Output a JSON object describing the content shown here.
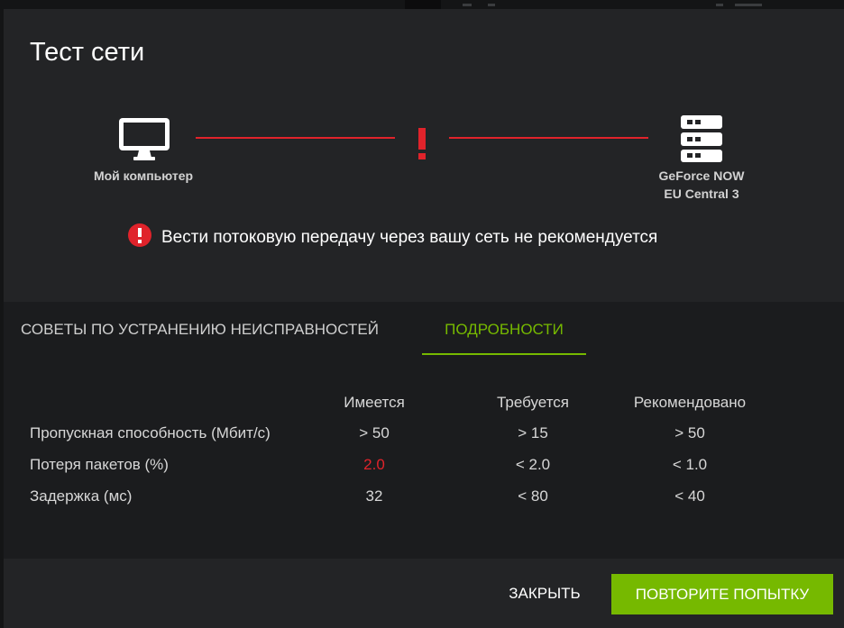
{
  "dialog": {
    "title": "Тест сети"
  },
  "diagram": {
    "source": {
      "label": "Мой компьютер",
      "icon": "monitor-icon"
    },
    "destination": {
      "label_line1": "GeForce NOW",
      "label_line2": "EU Central 3",
      "icon": "server-rack-icon"
    },
    "connection_status": "!",
    "connection_color": "#e0232b"
  },
  "warning": {
    "icon": "error-circle-icon",
    "text": "Вести потоковую передачу через вашу сеть не рекомендуется"
  },
  "tabs": [
    {
      "label": "СОВЕТЫ ПО УСТРАНЕНИЮ НЕИСПРАВНОСТЕЙ",
      "active": false
    },
    {
      "label": "ПОДРОБНОСТИ",
      "active": true
    }
  ],
  "details_table": {
    "headers": [
      "Имеется",
      "Требуется",
      "Рекомендовано"
    ],
    "rows": [
      {
        "label": "Пропускная способность (Мбит/с)",
        "values": [
          "> 50",
          "> 15",
          "> 50"
        ]
      },
      {
        "label": "Потеря пакетов (%)",
        "values": [
          "2.0",
          "< 2.0",
          "< 1.0"
        ]
      },
      {
        "label": "Задержка (мс)",
        "values": [
          "32",
          "< 80",
          "< 40"
        ]
      }
    ]
  },
  "footer": {
    "close_label": "ЗАКРЫТЬ",
    "retry_label": "ПОВТОРИТЕ ПОПЫТКУ"
  },
  "colors": {
    "accent": "#76b900",
    "error": "#e0232b",
    "background": "#1b1c1e",
    "panel": "#232426"
  }
}
